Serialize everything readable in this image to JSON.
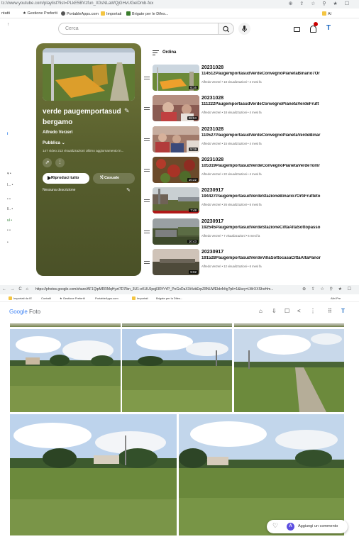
{
  "yt_browser": {
    "url": "tc://www.youtube.com/playlist?list=PLkE5BVzfun_X0sNLaWQjGHvUGeiDmb-fox",
    "bookmarks": [
      "ntatti",
      "Gestione Preferiti",
      "PortableApps.com",
      "Importati",
      "Brigate per le Difes..."
    ],
    "bookmark_right": "Al"
  },
  "yt_masthead": {
    "search_placeholder": "Cerca",
    "edge_arrow": "↑"
  },
  "playlist": {
    "title": "verde paugemportasud bergamo",
    "owner": "Alfredo Verzeri",
    "visibility": "Pubblica",
    "stats": "147 video   213 visualizzazioni   Ultimo aggiornamento in...",
    "play_all": "Riproduci tutto",
    "shuffle": "Casuale",
    "description": "Nessuna descrizione",
    "accent_color": "#5c632f"
  },
  "sort_label": "Ordina",
  "videos": [
    {
      "title1": "20231028",
      "title2": "114512PaugemportasudVerdeConvegnoPianetaBinario7Or",
      "meta": "Alfredo Verzeri • 18 visualizzazioni • 4 mesi fa",
      "duration": "6:16"
    },
    {
      "title1": "20231028",
      "title2": "111222PaugemportasudVerdeConvegnoPianetaVerdeFrutt",
      "meta": "Alfredo Verzeri • 18 visualizzazioni • 4 mesi fa",
      "duration": "28:53"
    },
    {
      "title1": "20231028",
      "title2": "110527PaugemportasudVerdeConvegnoPianetaVerdeBinar",
      "meta": "Alfredo Verzeri • 15 visualizzazioni • 4 mesi fa",
      "duration": "5:19"
    },
    {
      "title1": "20231028",
      "title2": "105319PaugemportasudVerdeConvegnoPianetaVerdeTomr",
      "meta": "Alfredo Verzeri • 22 visualizzazioni • 4 mesi fa",
      "duration": "10:22"
    },
    {
      "title1": "20230917",
      "title2": "194427PaugemportasudVerdeStazioneBinario7OrtiFrutteto",
      "meta": "Alfredo Verzeri • 26 visualizzazioni • 6 mesi fa",
      "duration": "7:48"
    },
    {
      "title1": "20230917",
      "title2": "192545PaugemportasudVerdeStazioneCittàAltaSottopasso",
      "meta": "Alfredo Verzeri • 7 visualizzazioni • 6 mesi fa",
      "duration": "10:43"
    },
    {
      "title1": "20230917",
      "title2": "191528PaugemportasudVerdeVillaSottocasaCittàAltaPanor",
      "meta": "Alfredo Verzeri • 12 visualizzazioni • 6 mesi fa",
      "duration": "9:02"
    }
  ],
  "gp_browser": {
    "url": "https://photos.google.com/share/AF1QipMRRMqHyzt7D7Ibn_3U1-eKUUJpqjI3RYrYP_PoGoDaXXi4zbErpZ8NUWEbb4rItg?pli=1&key=LWrXXShoHm...",
    "bookmarks": [
      "Importati da IE",
      "Contatti",
      "Gestione Preferiti",
      "PortableApps.com",
      "Importati",
      "Brigate per la Difes..."
    ],
    "bookmark_right": "Altri Pre"
  },
  "gp_header": {
    "logo_google": "Google",
    "logo_foto": "Foto"
  },
  "comment_bar": {
    "avatar_letter": "A",
    "label": "Aggiungi un commento"
  }
}
